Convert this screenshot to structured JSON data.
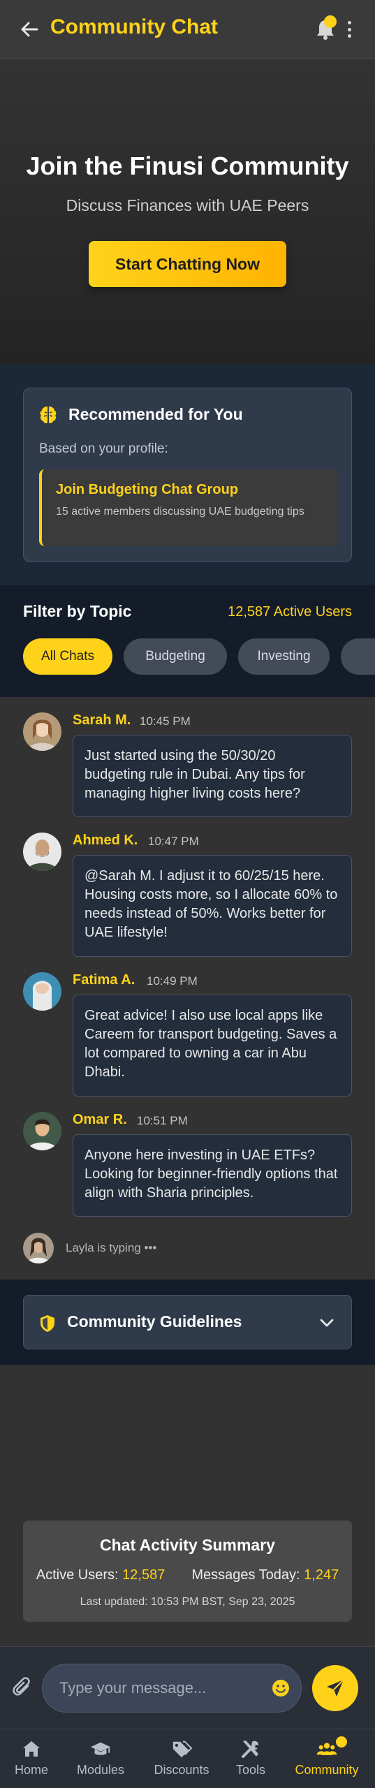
{
  "header": {
    "title": "Community Chat",
    "back_icon": "arrow-left-icon",
    "notification_icon": "bell-icon",
    "menu_icon": "more-vertical-icon"
  },
  "hero": {
    "title": "Join the Finusi Community",
    "subtitle": "Discuss Finances with UAE Peers",
    "cta_label": "Start Chatting Now"
  },
  "recommended": {
    "icon": "brain-icon",
    "title": "Recommended for You",
    "profile_note": "Based on your profile:",
    "item": {
      "title": "Join Budgeting Chat Group",
      "description": "15 active members discussing UAE budgeting tips"
    }
  },
  "filter": {
    "title": "Filter by Topic",
    "active_users": "12,587 Active Users",
    "chips": [
      {
        "label": "All Chats",
        "active": true
      },
      {
        "label": "Budgeting",
        "active": false
      },
      {
        "label": "Investing",
        "active": false
      }
    ]
  },
  "messages": [
    {
      "name": "Sarah M.",
      "time": "10:45 PM",
      "text": "Just started using the 50/30/20 budgeting rule in Dubai. Any tips for managing higher living costs here?"
    },
    {
      "name": "Ahmed K.",
      "time": "10:47 PM",
      "text": "@Sarah M. I adjust it to 60/25/15 here. Housing costs more, so I allocate 60% to needs instead of 50%. Works better for UAE lifestyle!"
    },
    {
      "name": "Fatima A.",
      "time": "10:49 PM",
      "text": "Great advice! I also use local apps like Careem for transport budgeting. Saves a lot compared to owning a car in Abu Dhabi."
    },
    {
      "name": "Omar R.",
      "time": "10:51 PM",
      "text": "Anyone here investing in UAE ETFs? Looking for beginner-friendly options that align with Sharia principles."
    }
  ],
  "typing": {
    "text": "Layla is typing •••"
  },
  "guidelines": {
    "icon": "shield-icon",
    "title": "Community Guidelines",
    "chevron_icon": "chevron-down-icon"
  },
  "summary": {
    "title": "Chat Activity Summary",
    "active_users_label": "Active Users:",
    "active_users_value": "12,587",
    "messages_label": "Messages Today:",
    "messages_value": "1,247",
    "last_updated": "Last updated: 10:53 PM BST, Sep 23, 2025"
  },
  "composer": {
    "placeholder": "Type your message...",
    "attach_icon": "paperclip-icon",
    "emoji_icon": "smile-icon",
    "send_icon": "send-icon"
  },
  "nav": [
    {
      "label": "Home",
      "icon": "home-icon",
      "active": false
    },
    {
      "label": "Modules",
      "icon": "graduation-cap-icon",
      "active": false
    },
    {
      "label": "Discounts",
      "icon": "tags-icon",
      "active": false
    },
    {
      "label": "Tools",
      "icon": "tools-icon",
      "active": false
    },
    {
      "label": "Community",
      "icon": "users-icon",
      "active": true
    }
  ],
  "colors": {
    "accent": "#ffd21a",
    "header_bg": "#3a3a3a",
    "navy_section": "#1c2738",
    "bubble_bg": "#232d3c"
  }
}
